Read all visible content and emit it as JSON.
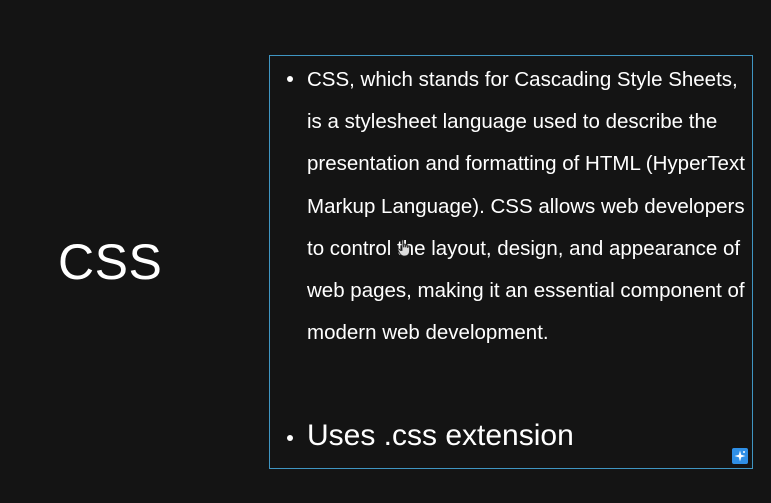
{
  "slide": {
    "title": "CSS",
    "bullets": [
      {
        "text": "CSS, which stands for Cascading Style Sheets, is a stylesheet language used to describe the presentation and formatting of HTML (HyperText Markup Language). CSS allows web developers to control the layout, design, and appearance of web pages, making it an essential component of modern web development."
      },
      {
        "text": "Uses .css extension"
      }
    ]
  },
  "colors": {
    "background": "#141414",
    "text": "#ffffff",
    "textbox_border": "#3f95c2",
    "corner_button": "#2f8fe6"
  },
  "icons": {
    "corner_button_icon": "sparkle-icon",
    "cursor_icon": "hand-cursor-icon"
  }
}
